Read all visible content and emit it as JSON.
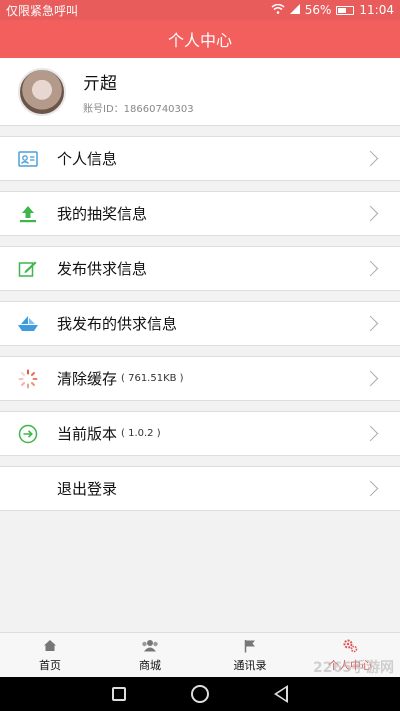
{
  "status_bar": {
    "left_text": "仅限紧急呼叫",
    "battery": "56%",
    "time": "11:04"
  },
  "header": {
    "title": "个人中心"
  },
  "profile": {
    "name": "亓超",
    "id_text": "账号ID：18660740303"
  },
  "menu": [
    {
      "label": "个人信息",
      "sub": "",
      "icon": "id-card-icon"
    },
    {
      "label": "我的抽奖信息",
      "sub": "",
      "icon": "upload-icon"
    },
    {
      "label": "发布供求信息",
      "sub": "",
      "icon": "edit-icon"
    },
    {
      "label": "我发布的供求信息",
      "sub": "",
      "icon": "boat-icon"
    },
    {
      "label": "清除缓存",
      "sub": "( 761.51KB )",
      "icon": "spinner-icon"
    },
    {
      "label": "当前版本",
      "sub": "( 1.0.2 )",
      "icon": "arrow-circle-icon"
    },
    {
      "label": "退出登录",
      "sub": "",
      "icon": ""
    }
  ],
  "bottom_nav": [
    {
      "label": "首页",
      "icon": "home-icon"
    },
    {
      "label": "商城",
      "icon": "users-icon"
    },
    {
      "label": "通讯录",
      "icon": "flag-icon"
    },
    {
      "label": "个人中心",
      "icon": "gear-icon",
      "active": true
    }
  ],
  "watermark": "2265手游网",
  "colors": {
    "accent": "#f25f5c",
    "active_tab": "#e25555"
  }
}
